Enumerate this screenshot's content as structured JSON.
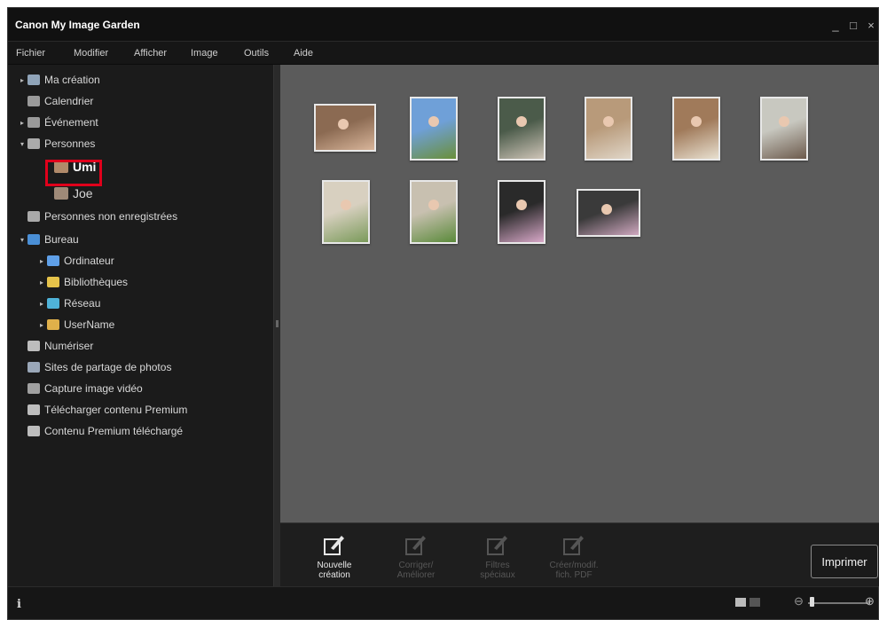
{
  "app": {
    "title": "Canon My Image Garden"
  },
  "window_controls": {
    "minimize": "_",
    "maximize": "□",
    "close": "×"
  },
  "menu": [
    "Fichier",
    "Modifier",
    "Afficher",
    "Image",
    "Outils",
    "Aide"
  ],
  "tree": [
    {
      "label": "Ma création",
      "arrow": "▸",
      "icon": "creation-icon",
      "color": "#8fa3b8"
    },
    {
      "label": "Calendrier",
      "arrow": "",
      "icon": "calendar-icon",
      "color": "#9a9a9a"
    },
    {
      "label": "Événement",
      "arrow": "▸",
      "icon": "event-icon",
      "color": "#9a9a9a"
    },
    {
      "label": "Personnes",
      "arrow": "▾",
      "icon": "person-icon",
      "color": "#aaaaaa"
    },
    {
      "label": "Umi",
      "arrow": "",
      "icon": "photo-icon",
      "color": "#b08a6a",
      "selected": true
    },
    {
      "label": "Joe",
      "arrow": "",
      "icon": "photo-icon",
      "color": "#9f8a78"
    },
    {
      "label": "Personnes non enregistrées",
      "arrow": "",
      "icon": "person-unknown-icon",
      "color": "#aaaaaa"
    },
    {
      "label": "Bureau",
      "arrow": "▾",
      "icon": "desktop-icon",
      "color": "#4a8fd6"
    },
    {
      "label": "Ordinateur",
      "arrow": "▸",
      "icon": "computer-icon",
      "color": "#5fa0e8"
    },
    {
      "label": "Bibliothèques",
      "arrow": "▸",
      "icon": "library-icon",
      "color": "#e6c34a"
    },
    {
      "label": "Réseau",
      "arrow": "▸",
      "icon": "network-icon",
      "color": "#4fb3d9"
    },
    {
      "label": "UserName",
      "arrow": "▸",
      "icon": "user-folder-icon",
      "color": "#e0b04a"
    },
    {
      "label": "Numériser",
      "arrow": "",
      "icon": "scan-icon",
      "color": "#bdbdbd"
    },
    {
      "label": "Sites de partage de photos",
      "arrow": "",
      "icon": "photo-share-icon",
      "color": "#9aa7b8"
    },
    {
      "label": "Capture image vidéo",
      "arrow": "",
      "icon": "video-capture-icon",
      "color": "#a0a0a0"
    },
    {
      "label": "Télécharger contenu Premium",
      "arrow": "",
      "icon": "download-premium-icon",
      "color": "#bdbdbd"
    },
    {
      "label": "Contenu Premium téléchargé",
      "arrow": "",
      "icon": "premium-folder-icon",
      "color": "#bdbdbd"
    }
  ],
  "photos": [
    {
      "colors": [
        "#8b6a52",
        "#d8b59a"
      ]
    },
    {
      "colors": [
        "#6fa0d8",
        "#6a8f3a"
      ]
    },
    {
      "colors": [
        "#4b5b4a",
        "#cfc5b8"
      ]
    },
    {
      "colors": [
        "#b89a7a",
        "#e0d6c8"
      ]
    },
    {
      "colors": [
        "#a07a5a",
        "#e8e0d0"
      ]
    },
    {
      "colors": [
        "#c8c8c0",
        "#6c5a4c"
      ]
    },
    {
      "colors": [
        "#d8d0c0",
        "#7a9a5a"
      ]
    },
    {
      "colors": [
        "#c8c0b0",
        "#5a8a3a"
      ]
    },
    {
      "colors": [
        "#2a2a2a",
        "#d8a8c8"
      ]
    },
    {
      "colors": [
        "#3a3a3a",
        "#d0a8c0"
      ]
    }
  ],
  "actions": [
    {
      "label": "Nouvelle\ncréation",
      "enabled": true,
      "icon": "new-creation-icon"
    },
    {
      "label": "Corriger/\nAméliorer",
      "enabled": false,
      "icon": "correct-enhance-icon"
    },
    {
      "label": "Filtres\nspéciaux",
      "enabled": false,
      "icon": "special-filters-icon"
    },
    {
      "label": "Créer/modif.\nfich. PDF",
      "enabled": false,
      "icon": "pdf-icon"
    }
  ],
  "print_label": "Imprimer",
  "status": {
    "info": "i"
  }
}
